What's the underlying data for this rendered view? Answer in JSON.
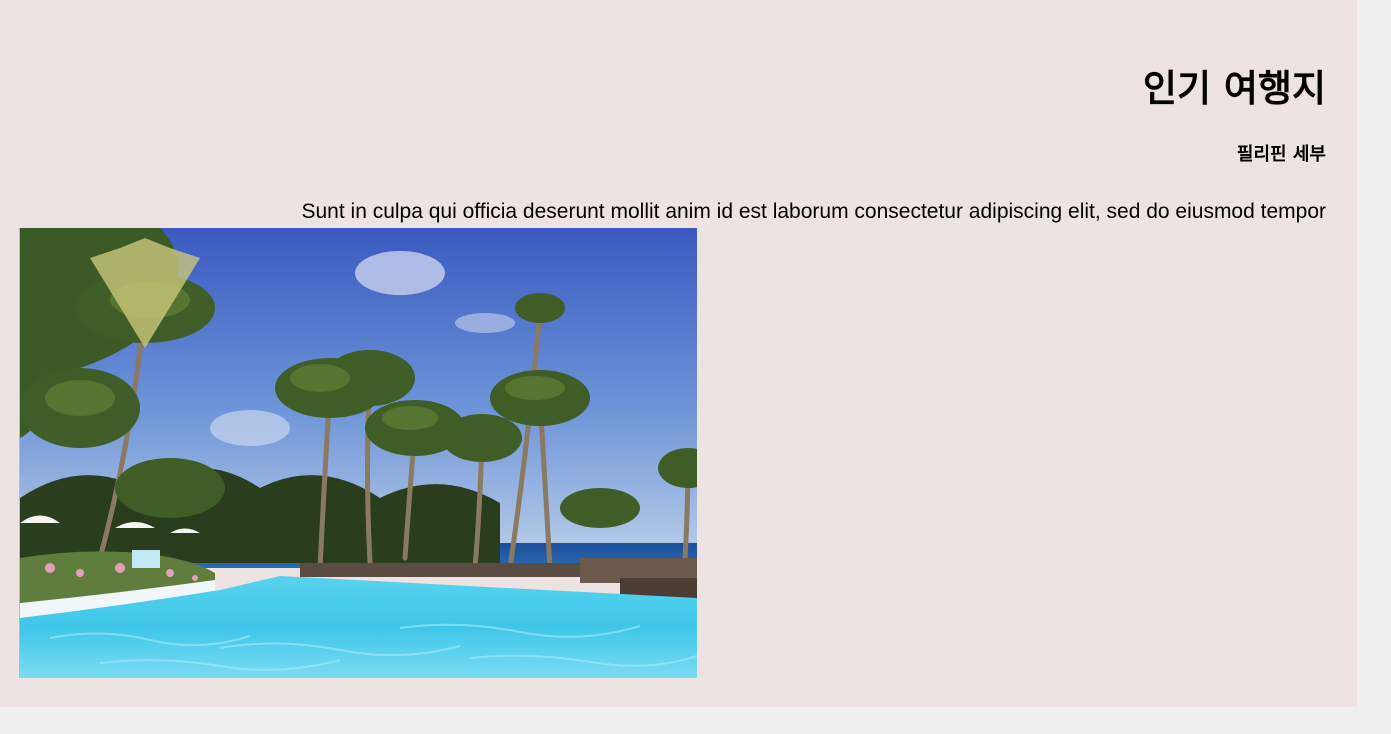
{
  "section": {
    "title": "인기 여행지",
    "destination": "필리핀 세부",
    "description": "Sunt in culpa qui officia deserunt mollit anim id est laborum consectetur adipiscing elit, sed do eiusmod tempor"
  },
  "photo": {
    "subject": "resort infinity pool with palm trees"
  },
  "colors": {
    "page_background": "#ede3e3",
    "outer_background": "#f0efef"
  }
}
